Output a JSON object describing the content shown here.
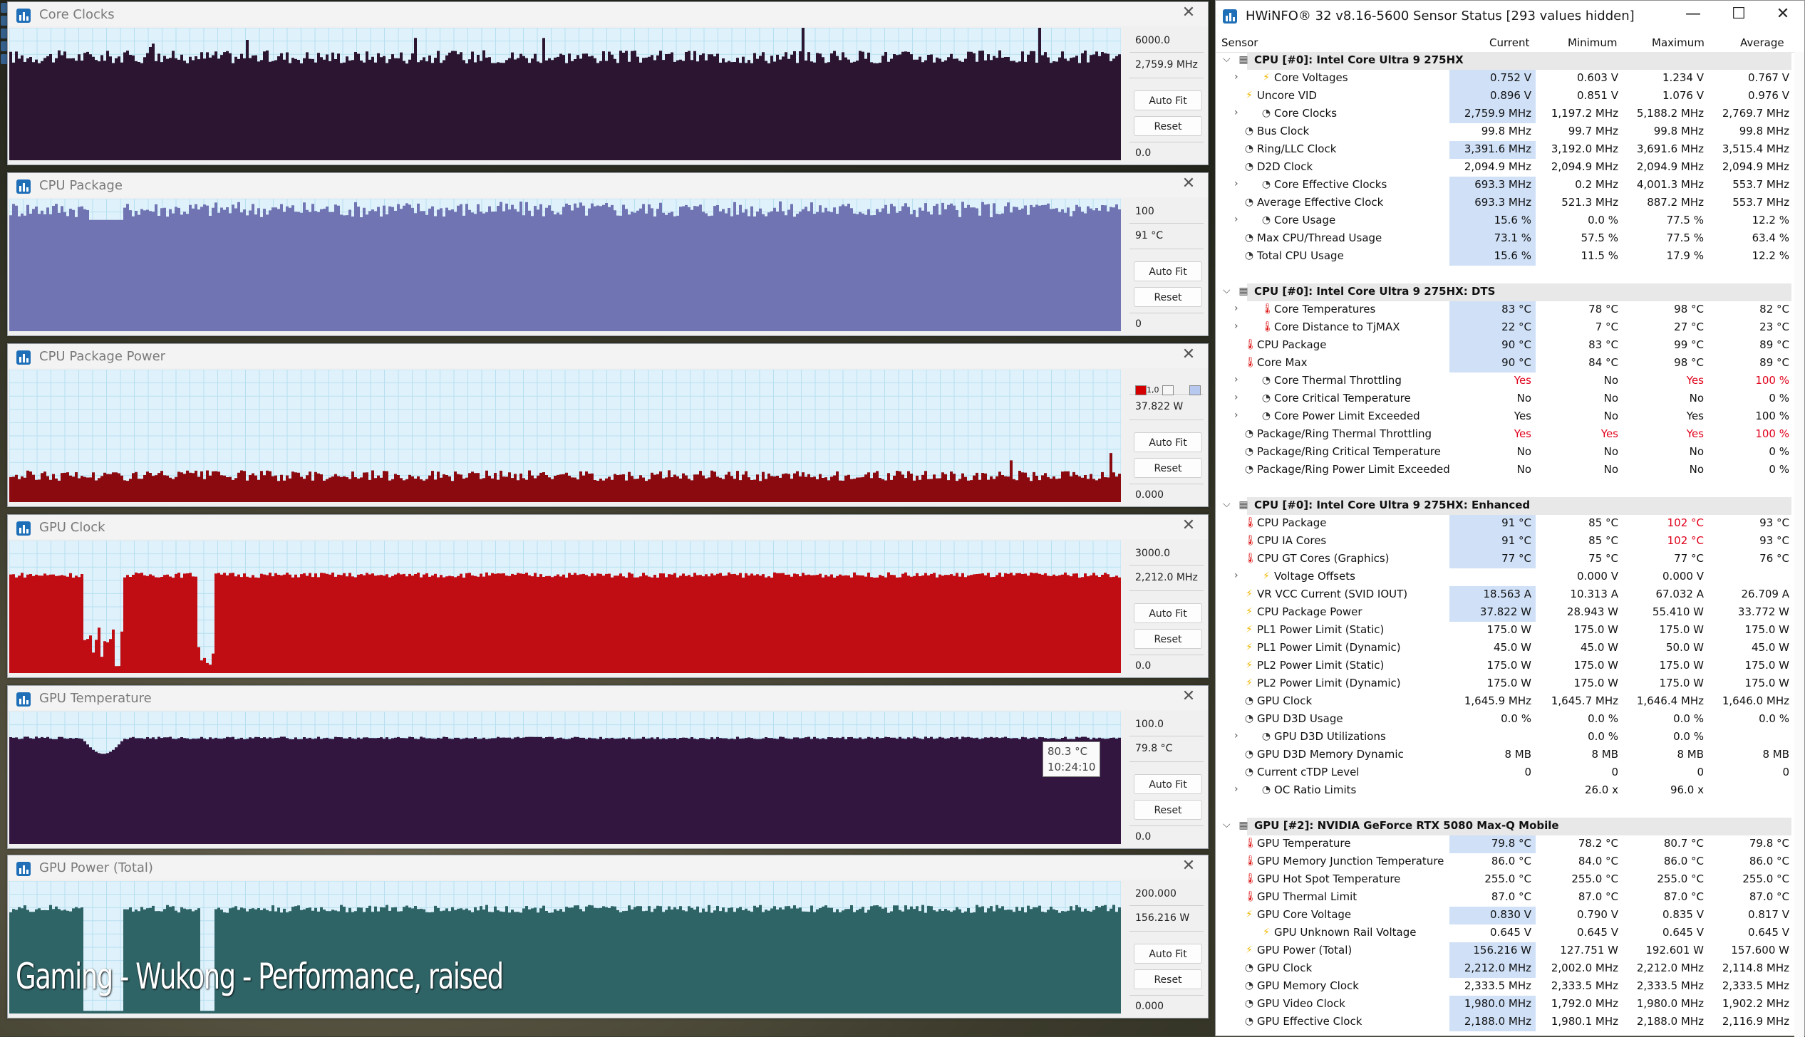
{
  "overlay": {
    "caption": "Gaming - Wukong - Performance, raised"
  },
  "graph_windows": [
    {
      "title": "Core Clocks",
      "max": "6000.0",
      "current": "2,759.9 MHz",
      "min": "0.0",
      "autofit": "Auto Fit",
      "reset": "Reset",
      "close": "✕",
      "fill": "#2b1530",
      "bg": "#dff2fb",
      "level": 0.78,
      "noise": 0.05,
      "spikes": 0.18
    },
    {
      "title": "CPU Package",
      "max": "100",
      "current": "91 °C",
      "min": "0",
      "autofit": "Auto Fit",
      "reset": "Reset",
      "close": "✕",
      "fill": "#7074b2",
      "bg": "#dff2fb",
      "level": 0.92,
      "noise": 0.06,
      "spikes": 0.0
    },
    {
      "title": "CPU Package Power",
      "max": "",
      "current": "37.822 W",
      "min": "0.000",
      "autofit": "Auto Fit",
      "reset": "Reset",
      "close": "✕",
      "fill": "#8b0a10",
      "bg": "#dff2fb",
      "level": 0.2,
      "noise": 0.04,
      "spikes": 0.1,
      "legend_colors": [
        "#d40000",
        "#f7f7f7",
        "#b7c9ee"
      ],
      "legend_label": "1,0"
    },
    {
      "title": "GPU Clock",
      "max": "3000.0",
      "current": "2,212.0 MHz",
      "min": "0.0",
      "autofit": "Auto Fit",
      "reset": "Reset",
      "close": "✕",
      "fill": "#c00d14",
      "bg": "#dff2fb",
      "level": 0.74,
      "noise": 0.02,
      "spikes": 0.0
    },
    {
      "title": "GPU Temperature",
      "max": "100.0",
      "current": "79.8 °C",
      "min": "0.0",
      "autofit": "Auto Fit",
      "reset": "Reset",
      "close": "✕",
      "fill": "#321640",
      "bg": "#dff2fb",
      "level": 0.8,
      "noise": 0.01,
      "spikes": 0.0,
      "tooltip": {
        "value": "80.3 °C",
        "time": "10:24:10"
      }
    },
    {
      "title": "GPU Power (Total)",
      "max": "200.000",
      "current": "156.216 W",
      "min": "0.000",
      "autofit": "Auto Fit",
      "reset": "Reset",
      "close": "✕",
      "fill": "#2f6467",
      "bg": "#dff2fb",
      "level": 0.79,
      "noise": 0.03,
      "spikes": 0.0
    }
  ],
  "hwinfo": {
    "title": "HWiNFO® 32 v8.16-5600 Sensor Status [293 values hidden]",
    "buttons": {
      "minimize": "—",
      "maximize": "☐",
      "close": "✕"
    },
    "columns": {
      "sensor": "Sensor",
      "current": "Current",
      "minimum": "Minimum",
      "maximum": "Maximum",
      "average": "Average"
    },
    "rows": [
      {
        "type": "group",
        "label": "CPU [#0]: Intel Core Ultra 9 275HX"
      },
      {
        "type": "item",
        "icon": "bolt",
        "exp": true,
        "indent": 1,
        "label": "Core Voltages",
        "cur": "0.752 V",
        "min": "0.603 V",
        "max": "1.234 V",
        "avg": "0.767 V",
        "hl": true
      },
      {
        "type": "item",
        "icon": "bolt",
        "label": "Uncore VID",
        "cur": "0.896 V",
        "min": "0.851 V",
        "max": "1.076 V",
        "avg": "0.976 V",
        "hl": true
      },
      {
        "type": "item",
        "icon": "clock",
        "exp": true,
        "indent": 1,
        "label": "Core Clocks",
        "cur": "2,759.9 MHz",
        "min": "1,197.2 MHz",
        "max": "5,188.2 MHz",
        "avg": "2,769.7 MHz",
        "hl": true
      },
      {
        "type": "item",
        "icon": "clock",
        "label": "Bus Clock",
        "cur": "99.8 MHz",
        "min": "99.7 MHz",
        "max": "99.8 MHz",
        "avg": "99.8 MHz"
      },
      {
        "type": "item",
        "icon": "clock",
        "label": "Ring/LLC Clock",
        "cur": "3,391.6 MHz",
        "min": "3,192.0 MHz",
        "max": "3,691.6 MHz",
        "avg": "3,515.4 MHz",
        "hl": true
      },
      {
        "type": "item",
        "icon": "clock",
        "label": "D2D Clock",
        "cur": "2,094.9 MHz",
        "min": "2,094.9 MHz",
        "max": "2,094.9 MHz",
        "avg": "2,094.9 MHz"
      },
      {
        "type": "item",
        "icon": "clock",
        "exp": true,
        "indent": 1,
        "label": "Core Effective Clocks",
        "cur": "693.3 MHz",
        "min": "0.2 MHz",
        "max": "4,001.3 MHz",
        "avg": "553.7 MHz",
        "hl": true
      },
      {
        "type": "item",
        "icon": "clock",
        "label": "Average Effective Clock",
        "cur": "693.3 MHz",
        "min": "521.3 MHz",
        "max": "887.2 MHz",
        "avg": "553.7 MHz",
        "hl": true
      },
      {
        "type": "item",
        "icon": "clock",
        "exp": true,
        "indent": 1,
        "label": "Core Usage",
        "cur": "15.6 %",
        "min": "0.0 %",
        "max": "77.5 %",
        "avg": "12.2 %",
        "hl": true
      },
      {
        "type": "item",
        "icon": "clock",
        "label": "Max CPU/Thread Usage",
        "cur": "73.1 %",
        "min": "57.5 %",
        "max": "77.5 %",
        "avg": "63.4 %",
        "hl": true
      },
      {
        "type": "item",
        "icon": "clock",
        "label": "Total CPU Usage",
        "cur": "15.6 %",
        "min": "11.5 %",
        "max": "17.9 %",
        "avg": "12.2 %",
        "hl": true
      },
      {
        "type": "blank"
      },
      {
        "type": "group",
        "label": "CPU [#0]: Intel Core Ultra 9 275HX: DTS"
      },
      {
        "type": "item",
        "icon": "therm",
        "exp": true,
        "indent": 1,
        "label": "Core Temperatures",
        "cur": "83 °C",
        "min": "78 °C",
        "max": "98 °C",
        "avg": "82 °C",
        "hl": true
      },
      {
        "type": "item",
        "icon": "therm",
        "exp": true,
        "indent": 1,
        "label": "Core Distance to TjMAX",
        "cur": "22 °C",
        "min": "7 °C",
        "max": "27 °C",
        "avg": "23 °C",
        "hl": true
      },
      {
        "type": "item",
        "icon": "therm",
        "label": "CPU Package",
        "cur": "90 °C",
        "min": "83 °C",
        "max": "99 °C",
        "avg": "89 °C",
        "hl": true
      },
      {
        "type": "item",
        "icon": "therm",
        "label": "Core Max",
        "cur": "90 °C",
        "min": "84 °C",
        "max": "98 °C",
        "avg": "89 °C",
        "hl": true
      },
      {
        "type": "item",
        "icon": "clock",
        "exp": true,
        "indent": 1,
        "label": "Core Thermal Throttling",
        "cur": "Yes",
        "min": "No",
        "max": "Yes",
        "avg": "100 %",
        "red": [
          "cur",
          "max",
          "avg"
        ]
      },
      {
        "type": "item",
        "icon": "clock",
        "exp": true,
        "indent": 1,
        "label": "Core Critical Temperature",
        "cur": "No",
        "min": "No",
        "max": "No",
        "avg": "0 %"
      },
      {
        "type": "item",
        "icon": "clock",
        "exp": true,
        "indent": 1,
        "label": "Core Power Limit Exceeded",
        "cur": "Yes",
        "min": "No",
        "max": "Yes",
        "avg": "100 %"
      },
      {
        "type": "item",
        "icon": "clock",
        "label": "Package/Ring Thermal Throttling",
        "cur": "Yes",
        "min": "Yes",
        "max": "Yes",
        "avg": "100 %",
        "red": [
          "cur",
          "min",
          "max",
          "avg"
        ]
      },
      {
        "type": "item",
        "icon": "clock",
        "label": "Package/Ring Critical Temperature",
        "cur": "No",
        "min": "No",
        "max": "No",
        "avg": "0 %"
      },
      {
        "type": "item",
        "icon": "clock",
        "label": "Package/Ring Power Limit Exceeded",
        "cur": "No",
        "min": "No",
        "max": "No",
        "avg": "0 %"
      },
      {
        "type": "blank"
      },
      {
        "type": "group",
        "label": "CPU [#0]: Intel Core Ultra 9 275HX: Enhanced"
      },
      {
        "type": "item",
        "icon": "therm",
        "label": "CPU Package",
        "cur": "91 °C",
        "min": "85 °C",
        "max": "102 °C",
        "avg": "93 °C",
        "hl": true,
        "red": [
          "max"
        ]
      },
      {
        "type": "item",
        "icon": "therm",
        "label": "CPU IA Cores",
        "cur": "91 °C",
        "min": "85 °C",
        "max": "102 °C",
        "avg": "93 °C",
        "hl": true,
        "red": [
          "max"
        ]
      },
      {
        "type": "item",
        "icon": "therm",
        "label": "CPU GT Cores (Graphics)",
        "cur": "77 °C",
        "min": "75 °C",
        "max": "77 °C",
        "avg": "76 °C",
        "hl": true
      },
      {
        "type": "item",
        "icon": "bolt",
        "exp": true,
        "indent": 1,
        "label": "Voltage Offsets",
        "cur": "",
        "min": "0.000 V",
        "max": "0.000 V",
        "avg": ""
      },
      {
        "type": "item",
        "icon": "bolt",
        "label": "VR VCC Current (SVID IOUT)",
        "cur": "18.563 A",
        "min": "10.313 A",
        "max": "67.032 A",
        "avg": "26.709 A",
        "hl": true
      },
      {
        "type": "item",
        "icon": "bolt",
        "label": "CPU Package Power",
        "cur": "37.822 W",
        "min": "28.943 W",
        "max": "55.410 W",
        "avg": "33.772 W",
        "hl": true
      },
      {
        "type": "item",
        "icon": "bolt",
        "label": "PL1 Power Limit (Static)",
        "cur": "175.0 W",
        "min": "175.0 W",
        "max": "175.0 W",
        "avg": "175.0 W"
      },
      {
        "type": "item",
        "icon": "bolt",
        "label": "PL1 Power Limit (Dynamic)",
        "cur": "45.0 W",
        "min": "45.0 W",
        "max": "50.0 W",
        "avg": "45.0 W"
      },
      {
        "type": "item",
        "icon": "bolt",
        "label": "PL2 Power Limit (Static)",
        "cur": "175.0 W",
        "min": "175.0 W",
        "max": "175.0 W",
        "avg": "175.0 W"
      },
      {
        "type": "item",
        "icon": "bolt",
        "label": "PL2 Power Limit (Dynamic)",
        "cur": "175.0 W",
        "min": "175.0 W",
        "max": "175.0 W",
        "avg": "175.0 W"
      },
      {
        "type": "item",
        "icon": "clock",
        "label": "GPU Clock",
        "cur": "1,645.9 MHz",
        "min": "1,645.7 MHz",
        "max": "1,646.4 MHz",
        "avg": "1,646.0 MHz"
      },
      {
        "type": "item",
        "icon": "clock",
        "label": "GPU D3D Usage",
        "cur": "0.0 %",
        "min": "0.0 %",
        "max": "0.0 %",
        "avg": "0.0 %"
      },
      {
        "type": "item",
        "icon": "clock",
        "exp": true,
        "indent": 1,
        "label": "GPU D3D Utilizations",
        "cur": "",
        "min": "0.0 %",
        "max": "0.0 %",
        "avg": ""
      },
      {
        "type": "item",
        "icon": "clock",
        "label": "GPU D3D Memory Dynamic",
        "cur": "8 MB",
        "min": "8 MB",
        "max": "8 MB",
        "avg": "8 MB"
      },
      {
        "type": "item",
        "icon": "clock",
        "label": "Current cTDP Level",
        "cur": "0",
        "min": "0",
        "max": "0",
        "avg": "0"
      },
      {
        "type": "item",
        "icon": "clock",
        "exp": true,
        "indent": 1,
        "label": "OC Ratio Limits",
        "cur": "",
        "min": "26.0 x",
        "max": "96.0 x",
        "avg": ""
      },
      {
        "type": "blank"
      },
      {
        "type": "group",
        "label": "GPU [#2]: NVIDIA  GeForce RTX 5080 Max-Q Mobile"
      },
      {
        "type": "item",
        "icon": "therm",
        "label": "GPU Temperature",
        "cur": "79.8 °C",
        "min": "78.2 °C",
        "max": "80.7 °C",
        "avg": "79.8 °C",
        "hl": true
      },
      {
        "type": "item",
        "icon": "therm",
        "label": "GPU Memory Junction Temperature",
        "cur": "86.0 °C",
        "min": "84.0 °C",
        "max": "86.0 °C",
        "avg": "86.0 °C"
      },
      {
        "type": "item",
        "icon": "therm",
        "label": "GPU Hot Spot Temperature",
        "cur": "255.0 °C",
        "min": "255.0 °C",
        "max": "255.0 °C",
        "avg": "255.0 °C"
      },
      {
        "type": "item",
        "icon": "therm",
        "label": "GPU Thermal Limit",
        "cur": "87.0 °C",
        "min": "87.0 °C",
        "max": "87.0 °C",
        "avg": "87.0 °C"
      },
      {
        "type": "item",
        "icon": "bolt",
        "label": "GPU Core Voltage",
        "cur": "0.830 V",
        "min": "0.790 V",
        "max": "0.835 V",
        "avg": "0.817 V",
        "hl": true
      },
      {
        "type": "item",
        "icon": "bolt",
        "indent": 1,
        "label": "GPU Unknown Rail Voltage",
        "cur": "0.645 V",
        "min": "0.645 V",
        "max": "0.645 V",
        "avg": "0.645 V"
      },
      {
        "type": "item",
        "icon": "bolt",
        "label": "GPU Power (Total)",
        "cur": "156.216 W",
        "min": "127.751 W",
        "max": "192.601 W",
        "avg": "157.600 W",
        "hl": true
      },
      {
        "type": "item",
        "icon": "clock",
        "label": "GPU Clock",
        "cur": "2,212.0 MHz",
        "min": "2,002.0 MHz",
        "max": "2,212.0 MHz",
        "avg": "2,114.8 MHz",
        "hl": true
      },
      {
        "type": "item",
        "icon": "clock",
        "label": "GPU Memory Clock",
        "cur": "2,333.5 MHz",
        "min": "2,333.5 MHz",
        "max": "2,333.5 MHz",
        "avg": "2,333.5 MHz"
      },
      {
        "type": "item",
        "icon": "clock",
        "label": "GPU Video Clock",
        "cur": "1,980.0 MHz",
        "min": "1,792.0 MHz",
        "max": "1,980.0 MHz",
        "avg": "1,902.2 MHz",
        "hl": true
      },
      {
        "type": "item",
        "icon": "clock",
        "label": "GPU Effective Clock",
        "cur": "2,188.0 MHz",
        "min": "1,980.1 MHz",
        "max": "2,188.0 MHz",
        "avg": "2,116.9 MHz",
        "hl": true
      }
    ]
  }
}
